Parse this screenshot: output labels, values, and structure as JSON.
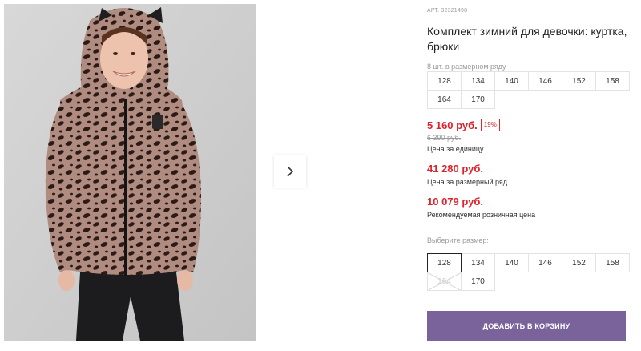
{
  "product": {
    "article": "АРТ. 32321498",
    "title": "Комплект зимний для девочки: куртка, брюки",
    "pack_note": "8 шт. в размерном ряду",
    "pack_sizes": [
      "128",
      "134",
      "140",
      "146",
      "152",
      "158",
      "164",
      "170"
    ]
  },
  "prices": {
    "unit_price": "5 160 руб.",
    "discount": "19%",
    "old_price": "6 390 руб.",
    "unit_label": "Цена за единицу",
    "pack_price": "41 280 руб.",
    "pack_label": "Цена за размерный ряд",
    "retail_price": "10 079 руб.",
    "retail_label": "Рекомендуемая розничная цена",
    "color": "#e0222b"
  },
  "size_select": {
    "label": "Выберите размер:",
    "sizes": [
      {
        "label": "128",
        "state": "selected"
      },
      {
        "label": "134",
        "state": "available"
      },
      {
        "label": "140",
        "state": "available"
      },
      {
        "label": "146",
        "state": "available"
      },
      {
        "label": "152",
        "state": "available"
      },
      {
        "label": "158",
        "state": "available"
      },
      {
        "label": "164",
        "state": "disabled"
      },
      {
        "label": "170",
        "state": "available"
      }
    ]
  },
  "cart": {
    "add_label": "ДОБАВИТЬ В КОРЗИНУ",
    "color": "#7a639b"
  },
  "gallery": {
    "next_icon": "chevron-right-icon",
    "photo": "girl-in-leopard-print-hooded-jacket"
  }
}
